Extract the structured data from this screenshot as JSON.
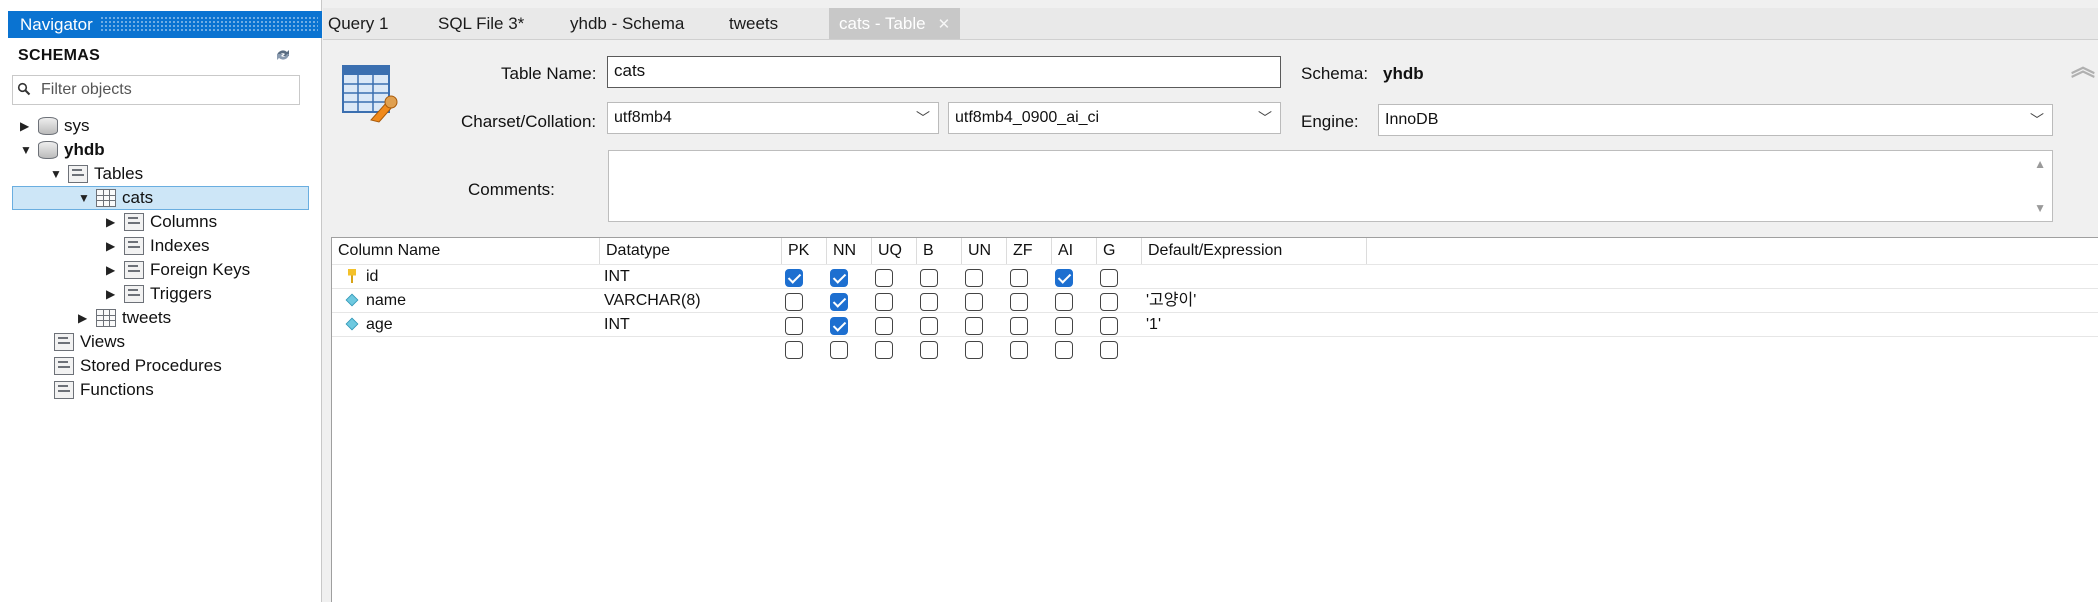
{
  "navigator": {
    "header": "Navigator",
    "schemas_title": "SCHEMAS",
    "filter_placeholder": "Filter objects",
    "tree": {
      "sys": "sys",
      "yhdb": "yhdb",
      "tables": "Tables",
      "cats": "cats",
      "columns": "Columns",
      "indexes": "Indexes",
      "foreign_keys": "Foreign Keys",
      "triggers": "Triggers",
      "tweets": "tweets",
      "views": "Views",
      "stored_procedures": "Stored Procedures",
      "functions": "Functions"
    }
  },
  "tabs": [
    {
      "label": "Query 1"
    },
    {
      "label": "SQL File 3*"
    },
    {
      "label": "yhdb - Schema"
    },
    {
      "label": "tweets"
    },
    {
      "label": "cats - Table",
      "active": true
    }
  ],
  "form": {
    "table_name_label": "Table Name:",
    "table_name": "cats",
    "schema_label": "Schema:",
    "schema": "yhdb",
    "charset_label": "Charset/Collation:",
    "charset": "utf8mb4",
    "collation": "utf8mb4_0900_ai_ci",
    "engine_label": "Engine:",
    "engine": "InnoDB",
    "comments_label": "Comments:",
    "comments": ""
  },
  "grid": {
    "headers": [
      "Column Name",
      "Datatype",
      "PK",
      "NN",
      "UQ",
      "B",
      "UN",
      "ZF",
      "AI",
      "G",
      "Default/Expression"
    ],
    "rows": [
      {
        "icon": "primary-key-icon",
        "name": "id",
        "datatype": "INT",
        "flags": [
          true,
          true,
          false,
          false,
          false,
          false,
          true,
          false
        ],
        "default": ""
      },
      {
        "icon": "column-diamond-icon",
        "name": "name",
        "datatype": "VARCHAR(8)",
        "flags": [
          false,
          true,
          false,
          false,
          false,
          false,
          false,
          false
        ],
        "default": "'고양이'"
      },
      {
        "icon": "column-diamond-icon",
        "name": "age",
        "datatype": "INT",
        "flags": [
          false,
          true,
          false,
          false,
          false,
          false,
          false,
          false
        ],
        "default": "'1'"
      },
      {
        "icon": "",
        "name": "",
        "datatype": "",
        "flags": [
          false,
          false,
          false,
          false,
          false,
          false,
          false,
          false
        ],
        "default": ""
      }
    ]
  },
  "colors": {
    "navigator_header": "#0a73d1",
    "selection": "#cde6f7",
    "checkbox_checked": "#1d6fd0",
    "active_tab": "#c8c8c8"
  }
}
